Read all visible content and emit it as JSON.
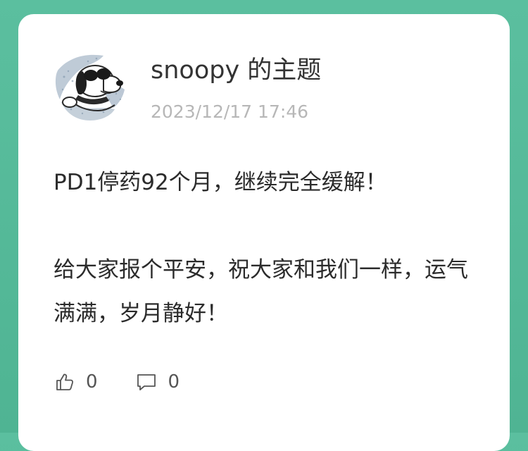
{
  "post": {
    "author_title": "snoopy 的主题",
    "timestamp": "2023/12/17 17:46",
    "paragraphs": [
      "PD1停药92个月，继续完全缓解！",
      "给大家报个平安，祝大家和我们一样，运气满满，岁月静好！"
    ]
  },
  "actions": {
    "like_count": "0",
    "comment_count": "0"
  },
  "icons": {
    "avatar": "snoopy-avatar-icon",
    "like": "thumbs-up-icon",
    "comment": "comment-bubble-icon"
  },
  "colors": {
    "background": "#55b99a",
    "card": "#ffffff",
    "timestamp": "#b7b7b7"
  }
}
